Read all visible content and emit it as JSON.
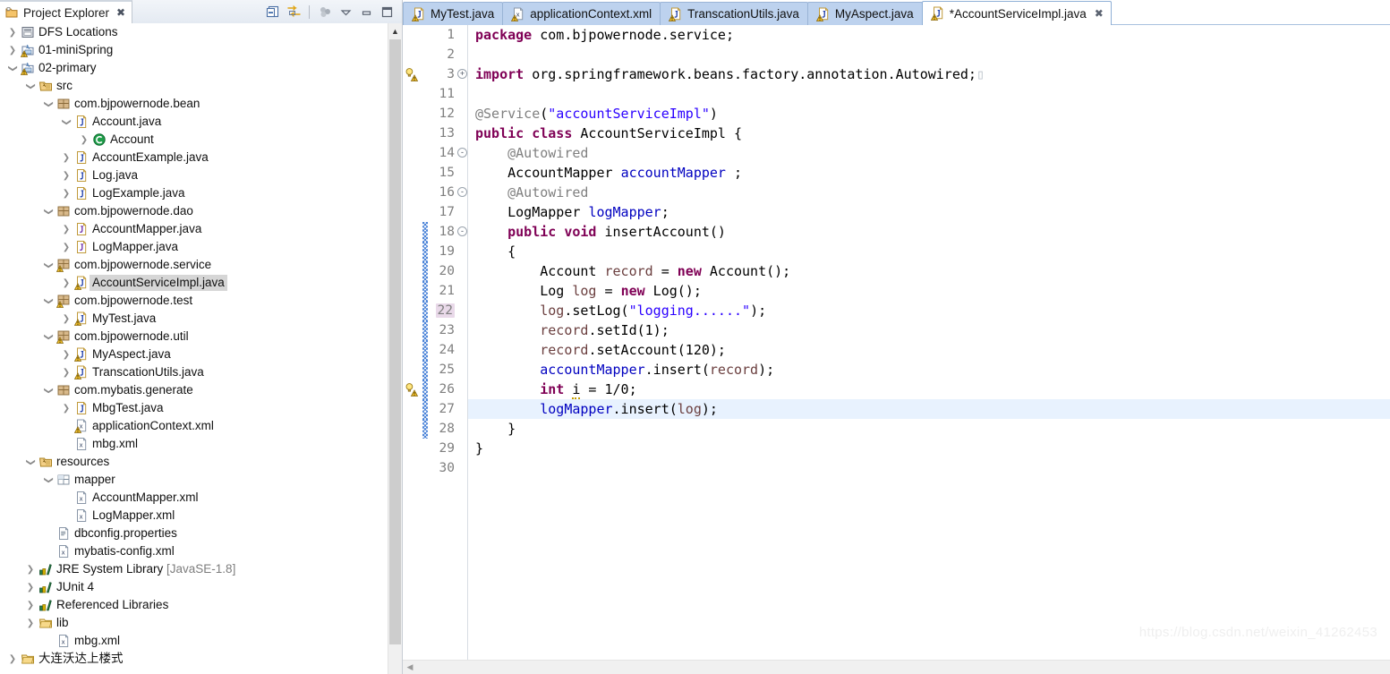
{
  "explorer": {
    "tab_label": "Project Explorer",
    "tab_close_icon": "close-icon",
    "toolbar": [
      {
        "name": "collapse-all-icon",
        "title": "Collapse All"
      },
      {
        "name": "link-with-editor-icon",
        "title": "Link with Editor"
      },
      {
        "name": "view-menu-icon",
        "title": "View Menu"
      },
      {
        "name": "chevron-down-icon",
        "title": "Chevron Down"
      },
      {
        "name": "minimize-icon",
        "title": "Minimize"
      },
      {
        "name": "maximize-icon",
        "title": "Maximize"
      }
    ],
    "tree": [
      {
        "label": "DFS Locations",
        "sub": "",
        "indent": 1,
        "twisty": "collapsed",
        "icon": "dfs-locations-icon"
      },
      {
        "label": "01-miniSpring",
        "sub": "",
        "indent": 1,
        "twisty": "collapsed",
        "icon": "java-project-icon"
      },
      {
        "label": "02-primary",
        "sub": "",
        "indent": 1,
        "twisty": "expanded",
        "icon": "java-project-icon"
      },
      {
        "label": "src",
        "sub": "",
        "indent": 2,
        "twisty": "expanded",
        "icon": "source-folder-icon"
      },
      {
        "label": "com.bjpowernode.bean",
        "sub": "",
        "indent": 3,
        "twisty": "expanded",
        "icon": "package-icon"
      },
      {
        "label": "Account.java",
        "sub": "",
        "indent": 4,
        "twisty": "expanded",
        "icon": "java-file-icon"
      },
      {
        "label": "Account",
        "sub": "",
        "indent": 5,
        "twisty": "collapsed",
        "icon": "class-icon"
      },
      {
        "label": "AccountExample.java",
        "sub": "",
        "indent": 4,
        "twisty": "collapsed",
        "icon": "java-file-icon"
      },
      {
        "label": "Log.java",
        "sub": "",
        "indent": 4,
        "twisty": "collapsed",
        "icon": "java-file-icon"
      },
      {
        "label": "LogExample.java",
        "sub": "",
        "indent": 4,
        "twisty": "collapsed",
        "icon": "java-file-icon"
      },
      {
        "label": "com.bjpowernode.dao",
        "sub": "",
        "indent": 3,
        "twisty": "expanded",
        "icon": "package-icon"
      },
      {
        "label": "AccountMapper.java",
        "sub": "",
        "indent": 4,
        "twisty": "collapsed",
        "icon": "java-interface-icon"
      },
      {
        "label": "LogMapper.java",
        "sub": "",
        "indent": 4,
        "twisty": "collapsed",
        "icon": "java-interface-icon"
      },
      {
        "label": "com.bjpowernode.service",
        "sub": "",
        "indent": 3,
        "twisty": "expanded",
        "icon": "package-warning-icon"
      },
      {
        "label": "AccountServiceImpl.java",
        "sub": "",
        "indent": 4,
        "twisty": "collapsed",
        "icon": "java-file-warning-icon",
        "selected": true
      },
      {
        "label": "com.bjpowernode.test",
        "sub": "",
        "indent": 3,
        "twisty": "expanded",
        "icon": "package-warning-icon"
      },
      {
        "label": "MyTest.java",
        "sub": "",
        "indent": 4,
        "twisty": "collapsed",
        "icon": "java-file-warning-icon"
      },
      {
        "label": "com.bjpowernode.util",
        "sub": "",
        "indent": 3,
        "twisty": "expanded",
        "icon": "package-warning-icon"
      },
      {
        "label": "MyAspect.java",
        "sub": "",
        "indent": 4,
        "twisty": "collapsed",
        "icon": "java-file-warning-icon"
      },
      {
        "label": "TranscationUtils.java",
        "sub": "",
        "indent": 4,
        "twisty": "collapsed",
        "icon": "java-file-warning-icon"
      },
      {
        "label": "com.mybatis.generate",
        "sub": "",
        "indent": 3,
        "twisty": "expanded",
        "icon": "package-icon"
      },
      {
        "label": "MbgTest.java",
        "sub": "",
        "indent": 4,
        "twisty": "collapsed",
        "icon": "java-file-icon"
      },
      {
        "label": "applicationContext.xml",
        "sub": "",
        "indent": 4,
        "twisty": "none",
        "icon": "xml-file-warning-icon"
      },
      {
        "label": "mbg.xml",
        "sub": "",
        "indent": 4,
        "twisty": "none",
        "icon": "xml-file-icon"
      },
      {
        "label": "resources",
        "sub": "",
        "indent": 2,
        "twisty": "expanded",
        "icon": "source-folder-icon"
      },
      {
        "label": "mapper",
        "sub": "",
        "indent": 3,
        "twisty": "expanded",
        "icon": "folder-package-icon"
      },
      {
        "label": "AccountMapper.xml",
        "sub": "",
        "indent": 4,
        "twisty": "none",
        "icon": "xml-file-icon"
      },
      {
        "label": "LogMapper.xml",
        "sub": "",
        "indent": 4,
        "twisty": "none",
        "icon": "xml-file-icon"
      },
      {
        "label": "dbconfig.properties",
        "sub": "",
        "indent": 3,
        "twisty": "none",
        "icon": "properties-file-icon"
      },
      {
        "label": "mybatis-config.xml",
        "sub": "",
        "indent": 3,
        "twisty": "none",
        "icon": "xml-file-icon"
      },
      {
        "label": "JRE System Library",
        "sub": "[JavaSE-1.8]",
        "indent": 2,
        "twisty": "collapsed",
        "icon": "library-icon"
      },
      {
        "label": "JUnit 4",
        "sub": "",
        "indent": 2,
        "twisty": "collapsed",
        "icon": "library-icon"
      },
      {
        "label": "Referenced Libraries",
        "sub": "",
        "indent": 2,
        "twisty": "collapsed",
        "icon": "library-icon"
      },
      {
        "label": "lib",
        "sub": "",
        "indent": 2,
        "twisty": "collapsed",
        "icon": "folder-icon"
      },
      {
        "label": "mbg.xml",
        "sub": "",
        "indent": 3,
        "twisty": "none",
        "icon": "xml-file-icon"
      },
      {
        "label": "大连沃达上楼式",
        "sub": "",
        "indent": 1,
        "twisty": "collapsed",
        "icon": "folder-icon"
      }
    ]
  },
  "editor": {
    "tabs": [
      {
        "label": "MyTest.java",
        "icon": "java-file-warning-icon",
        "active": false,
        "closable": false
      },
      {
        "label": "applicationContext.xml",
        "icon": "xml-file-warning-icon",
        "active": false,
        "closable": false
      },
      {
        "label": "TranscationUtils.java",
        "icon": "java-file-warning-icon",
        "active": false,
        "closable": false
      },
      {
        "label": "MyAspect.java",
        "icon": "java-file-warning-icon",
        "active": false,
        "closable": false
      },
      {
        "label": "*AccountServiceImpl.java",
        "icon": "java-file-warning-icon",
        "active": true,
        "closable": true
      }
    ],
    "close_icon": "close-icon",
    "current_line": 27,
    "highlighted_line_number": 22,
    "change_bar_range": [
      18,
      28
    ],
    "lines": [
      {
        "n": "1",
        "fold": "",
        "ann": "",
        "changed": false,
        "tokens": [
          {
            "t": "package",
            "c": "k"
          },
          {
            "t": " com.bjpowernode.service;",
            "c": ""
          }
        ]
      },
      {
        "n": "2",
        "fold": "",
        "ann": "",
        "changed": false,
        "tokens": []
      },
      {
        "n": "3",
        "fold": "+",
        "ann": "warning-bulb-icon",
        "changed": false,
        "tokens": [
          {
            "t": "import",
            "c": "k"
          },
          {
            "t": " org.springframework.beans.factory.annotation.Autowired;",
            "c": ""
          },
          {
            "t": "▯",
            "c": "box"
          }
        ]
      },
      {
        "n": "11",
        "fold": "",
        "ann": "",
        "changed": false,
        "tokens": []
      },
      {
        "n": "12",
        "fold": "",
        "ann": "",
        "changed": false,
        "tokens": [
          {
            "t": "@Service",
            "c": "a"
          },
          {
            "t": "(",
            "c": ""
          },
          {
            "t": "\"accountServiceImpl\"",
            "c": "s"
          },
          {
            "t": ")",
            "c": ""
          }
        ]
      },
      {
        "n": "13",
        "fold": "",
        "ann": "",
        "changed": false,
        "tokens": [
          {
            "t": "public class",
            "c": "k"
          },
          {
            "t": " AccountServiceImpl {",
            "c": ""
          }
        ]
      },
      {
        "n": "14",
        "fold": "-",
        "ann": "",
        "changed": false,
        "tokens": [
          {
            "t": "    @Autowired",
            "c": "a"
          }
        ]
      },
      {
        "n": "15",
        "fold": "",
        "ann": "",
        "changed": false,
        "tokens": [
          {
            "t": "    AccountMapper ",
            "c": ""
          },
          {
            "t": "accountMapper",
            "c": "f"
          },
          {
            "t": " ;",
            "c": ""
          }
        ]
      },
      {
        "n": "16",
        "fold": "-",
        "ann": "",
        "changed": false,
        "tokens": [
          {
            "t": "    @Autowired",
            "c": "a"
          }
        ]
      },
      {
        "n": "17",
        "fold": "",
        "ann": "",
        "changed": false,
        "tokens": [
          {
            "t": "    LogMapper ",
            "c": ""
          },
          {
            "t": "logMapper",
            "c": "f"
          },
          {
            "t": ";",
            "c": ""
          }
        ]
      },
      {
        "n": "18",
        "fold": "-",
        "ann": "",
        "changed": true,
        "tokens": [
          {
            "t": "    ",
            "c": ""
          },
          {
            "t": "public void",
            "c": "k"
          },
          {
            "t": " insertAccount()",
            "c": ""
          }
        ]
      },
      {
        "n": "19",
        "fold": "",
        "ann": "",
        "changed": true,
        "tokens": [
          {
            "t": "    {",
            "c": ""
          }
        ]
      },
      {
        "n": "20",
        "fold": "",
        "ann": "",
        "changed": true,
        "tokens": [
          {
            "t": "        Account ",
            "c": ""
          },
          {
            "t": "record",
            "c": "p"
          },
          {
            "t": " = ",
            "c": ""
          },
          {
            "t": "new",
            "c": "k"
          },
          {
            "t": " Account();",
            "c": ""
          }
        ]
      },
      {
        "n": "21",
        "fold": "",
        "ann": "",
        "changed": true,
        "tokens": [
          {
            "t": "        Log ",
            "c": ""
          },
          {
            "t": "log",
            "c": "p"
          },
          {
            "t": " = ",
            "c": ""
          },
          {
            "t": "new",
            "c": "k"
          },
          {
            "t": " Log();",
            "c": ""
          }
        ]
      },
      {
        "n": "22",
        "fold": "",
        "ann": "",
        "changed": true,
        "tokens": [
          {
            "t": "        ",
            "c": ""
          },
          {
            "t": "log",
            "c": "p"
          },
          {
            "t": ".setLog(",
            "c": ""
          },
          {
            "t": "\"logging......\"",
            "c": "s"
          },
          {
            "t": ");",
            "c": ""
          }
        ]
      },
      {
        "n": "23",
        "fold": "",
        "ann": "",
        "changed": true,
        "tokens": [
          {
            "t": "        ",
            "c": ""
          },
          {
            "t": "record",
            "c": "p"
          },
          {
            "t": ".setId(1);",
            "c": ""
          }
        ]
      },
      {
        "n": "24",
        "fold": "",
        "ann": "",
        "changed": true,
        "tokens": [
          {
            "t": "        ",
            "c": ""
          },
          {
            "t": "record",
            "c": "p"
          },
          {
            "t": ".setAccount(120);",
            "c": ""
          }
        ]
      },
      {
        "n": "25",
        "fold": "",
        "ann": "",
        "changed": true,
        "tokens": [
          {
            "t": "        ",
            "c": ""
          },
          {
            "t": "accountMapper",
            "c": "f"
          },
          {
            "t": ".insert(",
            "c": ""
          },
          {
            "t": "record",
            "c": "p"
          },
          {
            "t": ");",
            "c": ""
          }
        ]
      },
      {
        "n": "26",
        "fold": "",
        "ann": "warning-bulb-icon",
        "changed": true,
        "tokens": [
          {
            "t": "        ",
            "c": ""
          },
          {
            "t": "int",
            "c": "k"
          },
          {
            "t": " ",
            "c": ""
          },
          {
            "t": "i",
            "c": "warnu"
          },
          {
            "t": " = 1/0;",
            "c": ""
          }
        ]
      },
      {
        "n": "27",
        "fold": "",
        "ann": "",
        "changed": true,
        "tokens": [
          {
            "t": "        ",
            "c": ""
          },
          {
            "t": "logMapper",
            "c": "f"
          },
          {
            "t": ".insert(",
            "c": ""
          },
          {
            "t": "log",
            "c": "p"
          },
          {
            "t": ");",
            "c": ""
          }
        ]
      },
      {
        "n": "28",
        "fold": "",
        "ann": "",
        "changed": true,
        "tokens": [
          {
            "t": "    }",
            "c": ""
          }
        ]
      },
      {
        "n": "29",
        "fold": "",
        "ann": "",
        "changed": false,
        "tokens": [
          {
            "t": "}",
            "c": ""
          }
        ]
      },
      {
        "n": "30",
        "fold": "",
        "ann": "",
        "changed": false,
        "tokens": []
      }
    ]
  },
  "watermark": "https://blog.csdn.net/weixin_41262453",
  "colors": {
    "keyword": "#7F0055",
    "string": "#2A00FF",
    "annotation": "#808080",
    "field": "#0000C0",
    "local_var": "#6A3E3E",
    "selection": "#D6D6D6",
    "current_line": "#E8F2FE",
    "tab_inactive": "#BDD2EE",
    "line_number": "#7F7F7F"
  }
}
